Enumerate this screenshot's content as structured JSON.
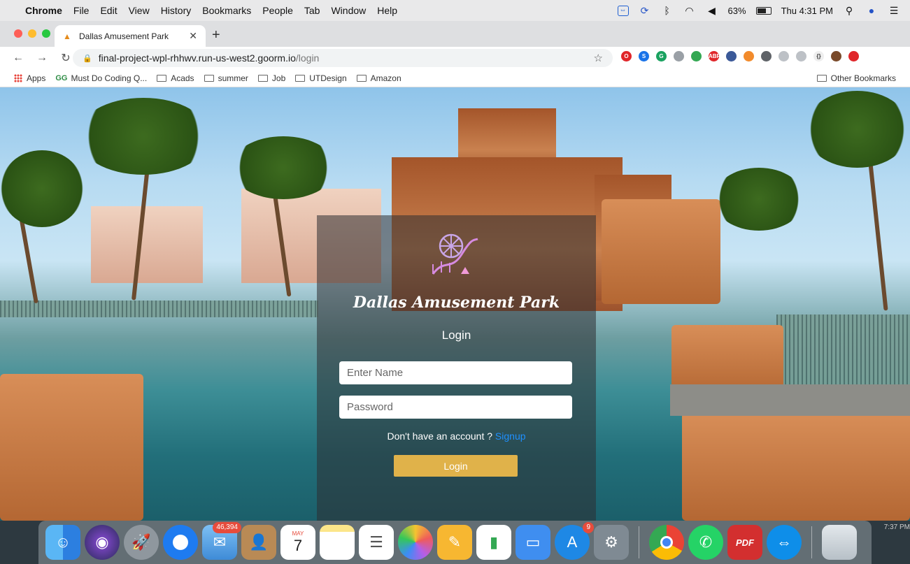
{
  "menubar": {
    "app_name": "Chrome",
    "items": [
      "File",
      "Edit",
      "View",
      "History",
      "Bookmarks",
      "People",
      "Tab",
      "Window",
      "Help"
    ],
    "battery": "63%",
    "clock": "Thu 4:31 PM"
  },
  "browser": {
    "tab_title": "Dallas Amusement Park",
    "url_host": "final-project-wpl-rhhwv.run-us-west2.goorm.io",
    "url_path": "/login",
    "bookmarks": [
      "Apps",
      "Must Do Coding Q...",
      "Acads",
      "summer",
      "Job",
      "UTDesign",
      "Amazon"
    ],
    "other_bookmarks": "Other Bookmarks",
    "gfg_icon_text": "GG"
  },
  "login": {
    "brand": "Dallas Amusement Park",
    "heading": "Login",
    "name_placeholder": "Enter Name",
    "password_placeholder": "Password",
    "signup_prompt": "Don't have an account ?",
    "signup_link": "Signup",
    "submit_label": "Login"
  },
  "dock": {
    "mail_badge": "46,394",
    "calendar_month": "MAY",
    "calendar_day": "7",
    "appstore_badge": "9",
    "pdf_label": "PDF",
    "clock_fragment": "7:37 PM"
  },
  "colors": {
    "accent_button": "#e0b24a",
    "link": "#1e90ff",
    "panel": "rgba(45,45,50,0.55)"
  }
}
